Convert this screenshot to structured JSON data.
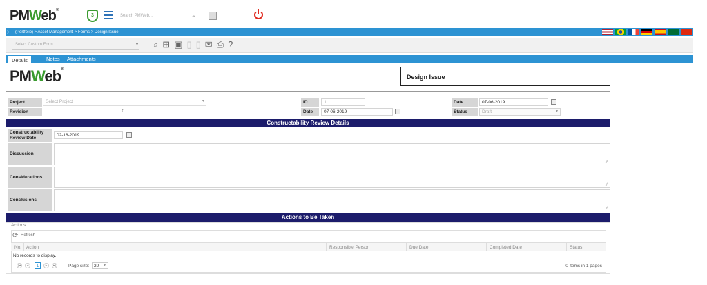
{
  "app": {
    "logo_text": "PMWeb",
    "logo_w": "W",
    "logo_pre": "PM",
    "logo_post": "eb",
    "logo_mark": "®",
    "badge": "3",
    "search_placeholder": "Search PMWeb..."
  },
  "breadcrumb": "(Portfolio) > Asset Management > Forms > Design Issue",
  "toolbar": {
    "form_placeholder": "Select Custom Form ...",
    "icons": [
      "search-icon",
      "add-icon",
      "save-icon",
      "copy-icon",
      "paste-icon",
      "email-icon",
      "print-icon",
      "help-icon"
    ],
    "help": "?"
  },
  "tabs": [
    {
      "label": "Details"
    },
    {
      "label": "Notes"
    },
    {
      "label": "Attachments"
    }
  ],
  "form": {
    "title": "Design Issue",
    "project_label": "Project",
    "project_placeholder": "Select Project",
    "revision_label": "Revision",
    "revision_value": "0",
    "id_label": "ID",
    "id_value": "1",
    "date_label": "Date",
    "date_value": "07-06-2019",
    "date2_label": "Date",
    "date2_value": "07-06-2019",
    "status_label": "Status",
    "status_value": "Draft"
  },
  "review": {
    "section_title": "Constructability Review Details",
    "review_date_label": "Constructability Review Date",
    "review_date_value": "02-18-2019",
    "discussion_label": "Discussion",
    "considerations_label": "Considerations",
    "conclusions_label": "Conclusions"
  },
  "actions": {
    "section_title": "Actions to Be Taken",
    "grid_label": "Actions",
    "refresh_label": "Refresh",
    "columns": [
      "No.",
      "Action",
      "Responsible Person",
      "Due Date",
      "Completed Date",
      "Status"
    ],
    "empty_text": "No records to display.",
    "page_number": "1",
    "page_size_label": "Page size:",
    "page_size": "20",
    "items_info": "0 items in 1 pages"
  },
  "colors": {
    "accent": "#2d93d3",
    "section": "#1c1c6b",
    "brand_green": "#3a9b2f",
    "power": "#e02b20"
  }
}
